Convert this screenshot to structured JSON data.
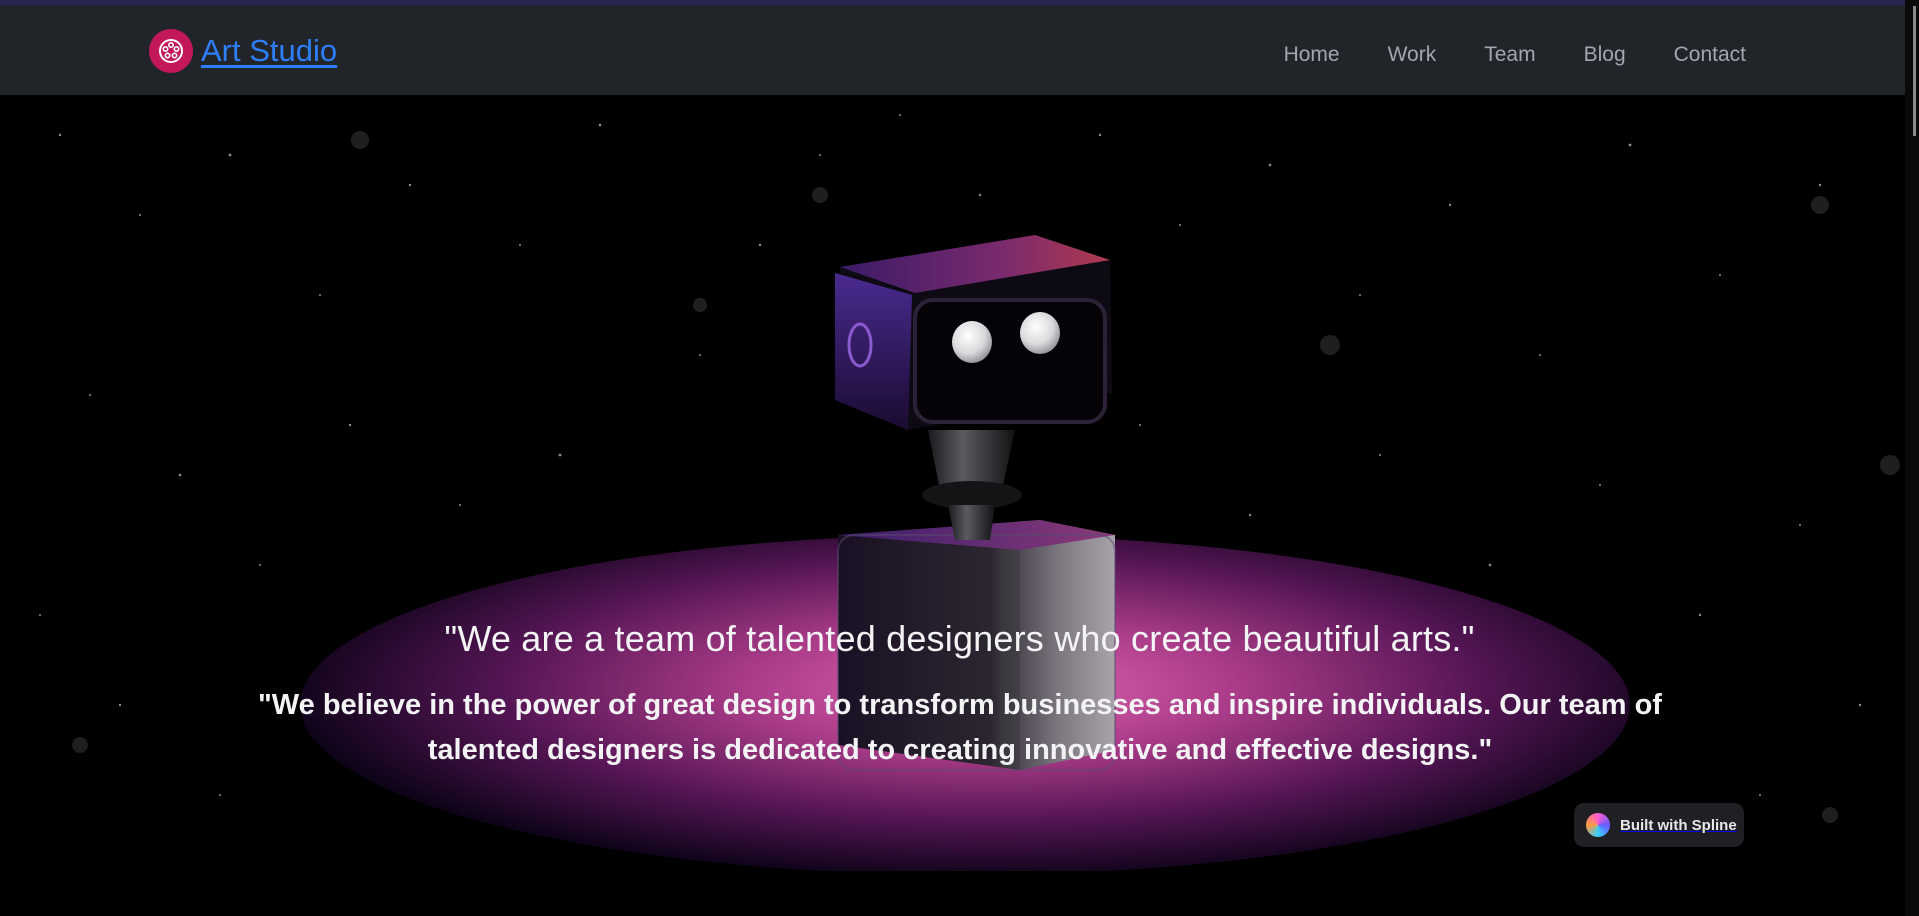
{
  "brand": {
    "name": "Art Studio",
    "logo_icon": "palette-icon",
    "logo_color": "#c2185b",
    "link_color": "#2d7ff9"
  },
  "nav": {
    "items": [
      "Home",
      "Work",
      "Team",
      "Blog",
      "Contact"
    ]
  },
  "hero": {
    "headline": "\"We are a team of talented designers who create beautiful arts.\"",
    "subline_1": "\"We believe in the power of great design to transform businesses and inspire individuals. Our team of",
    "subline_2": "talented designers is dedicated to creating innovative and effective designs.\"",
    "glow_color": "#e86ec0"
  },
  "badge": {
    "label": "Built with Spline"
  }
}
